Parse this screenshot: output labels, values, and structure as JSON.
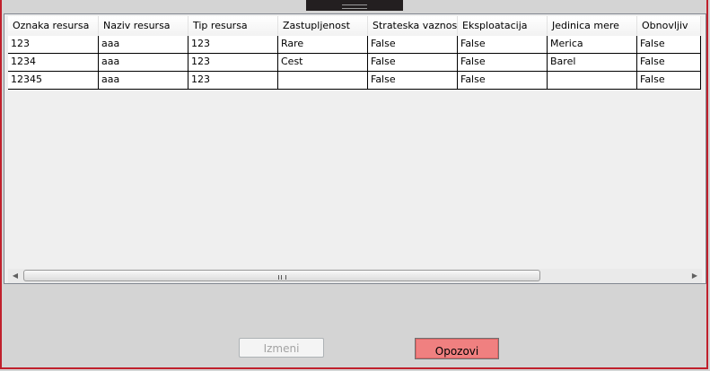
{
  "table": {
    "columns": [
      "Oznaka resursa",
      "Naziv resursa",
      "Tip resursa",
      "Zastupljenost",
      "Strateska vaznost",
      "Eksploatacija",
      "Jedinica mere",
      "Obnovljiv"
    ],
    "rows": [
      [
        "123",
        "aaa",
        "123",
        "Rare",
        "False",
        "False",
        "Merica",
        "False"
      ],
      [
        "1234",
        "aaa",
        "123",
        "Cest",
        "False",
        "False",
        "Barel",
        "False"
      ],
      [
        "12345",
        "aaa",
        "123",
        "",
        "False",
        "False",
        "",
        "False"
      ]
    ]
  },
  "scrollbar": {
    "left_arrow": "◀",
    "right_arrow": "▶"
  },
  "buttons": {
    "izmeni": "Izmeni",
    "opozovi": "Opozovi"
  }
}
